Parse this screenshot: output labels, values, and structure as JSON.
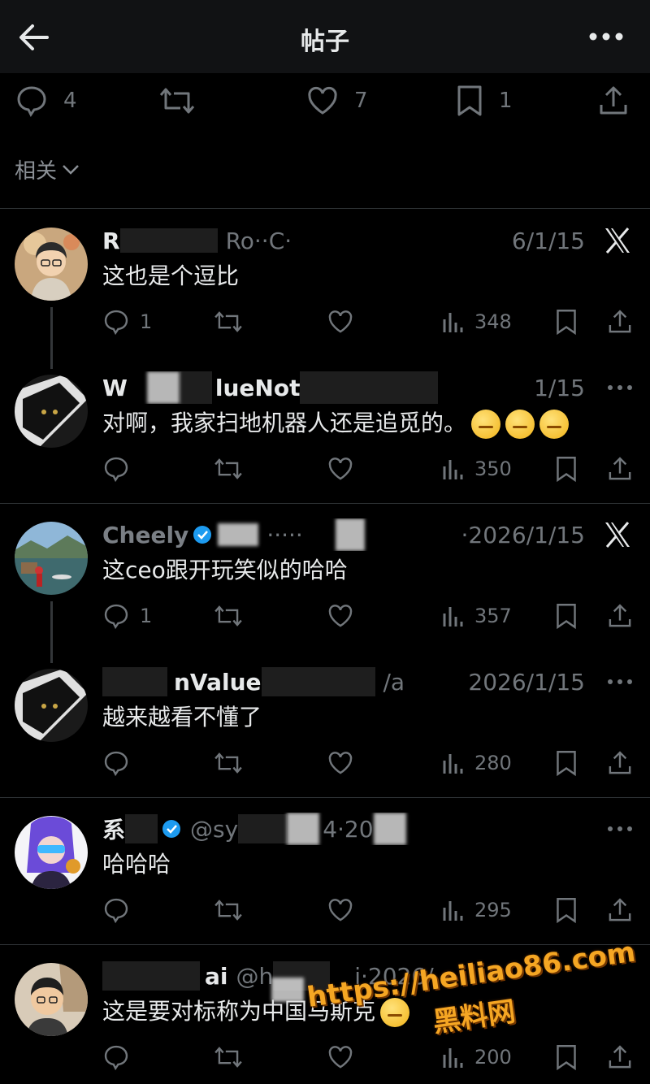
{
  "header": {
    "title": "帖子"
  },
  "stats": {
    "replies": "4",
    "likes": "7",
    "bookmarks": "1"
  },
  "related": {
    "label": "相关"
  },
  "posts": [
    {
      "name": "R",
      "handle": "Ro··C·",
      "date": "6/1/15",
      "text": "这也是个逗比",
      "replies": "1",
      "views": "348",
      "emojis": 0,
      "corner": "x"
    },
    {
      "name": "W",
      "handle": "lueNot",
      "date": "1/15",
      "text": "对啊，我家扫地机器人还是追觅的。",
      "replies": "",
      "views": "350",
      "emojis": 3,
      "corner": "dots"
    },
    {
      "name": "Cheely",
      "handle": "·····",
      "date": "·2026/1/15",
      "text": "这ceo跟开玩笑似的哈哈",
      "replies": "1",
      "views": "357",
      "emojis": 0,
      "corner": "x"
    },
    {
      "name": "nValue",
      "handle": "/a",
      "date": "2026/1/15",
      "text": "越来越看不懂了",
      "replies": "",
      "views": "280",
      "emojis": 0,
      "corner": "dots"
    },
    {
      "name": "系",
      "handle": "@sy",
      "date": "4·20",
      "text": "哈哈哈",
      "replies": "",
      "views": "295",
      "emojis": 0,
      "corner": "dots"
    },
    {
      "name": "ai",
      "handle": "@h",
      "date": "i·2026/",
      "text": "这是要对标称为中国马斯克",
      "replies": "",
      "views": "200",
      "emojis": 1,
      "corner": "none"
    }
  ],
  "watermark": {
    "url": "https://heiliao86.com",
    "site": "黑料网"
  },
  "colors": {
    "background": "#000000",
    "text": "#e7e9ea",
    "muted": "#71767b",
    "accent": "#1d9bf0",
    "watermark": "#f5a623"
  }
}
